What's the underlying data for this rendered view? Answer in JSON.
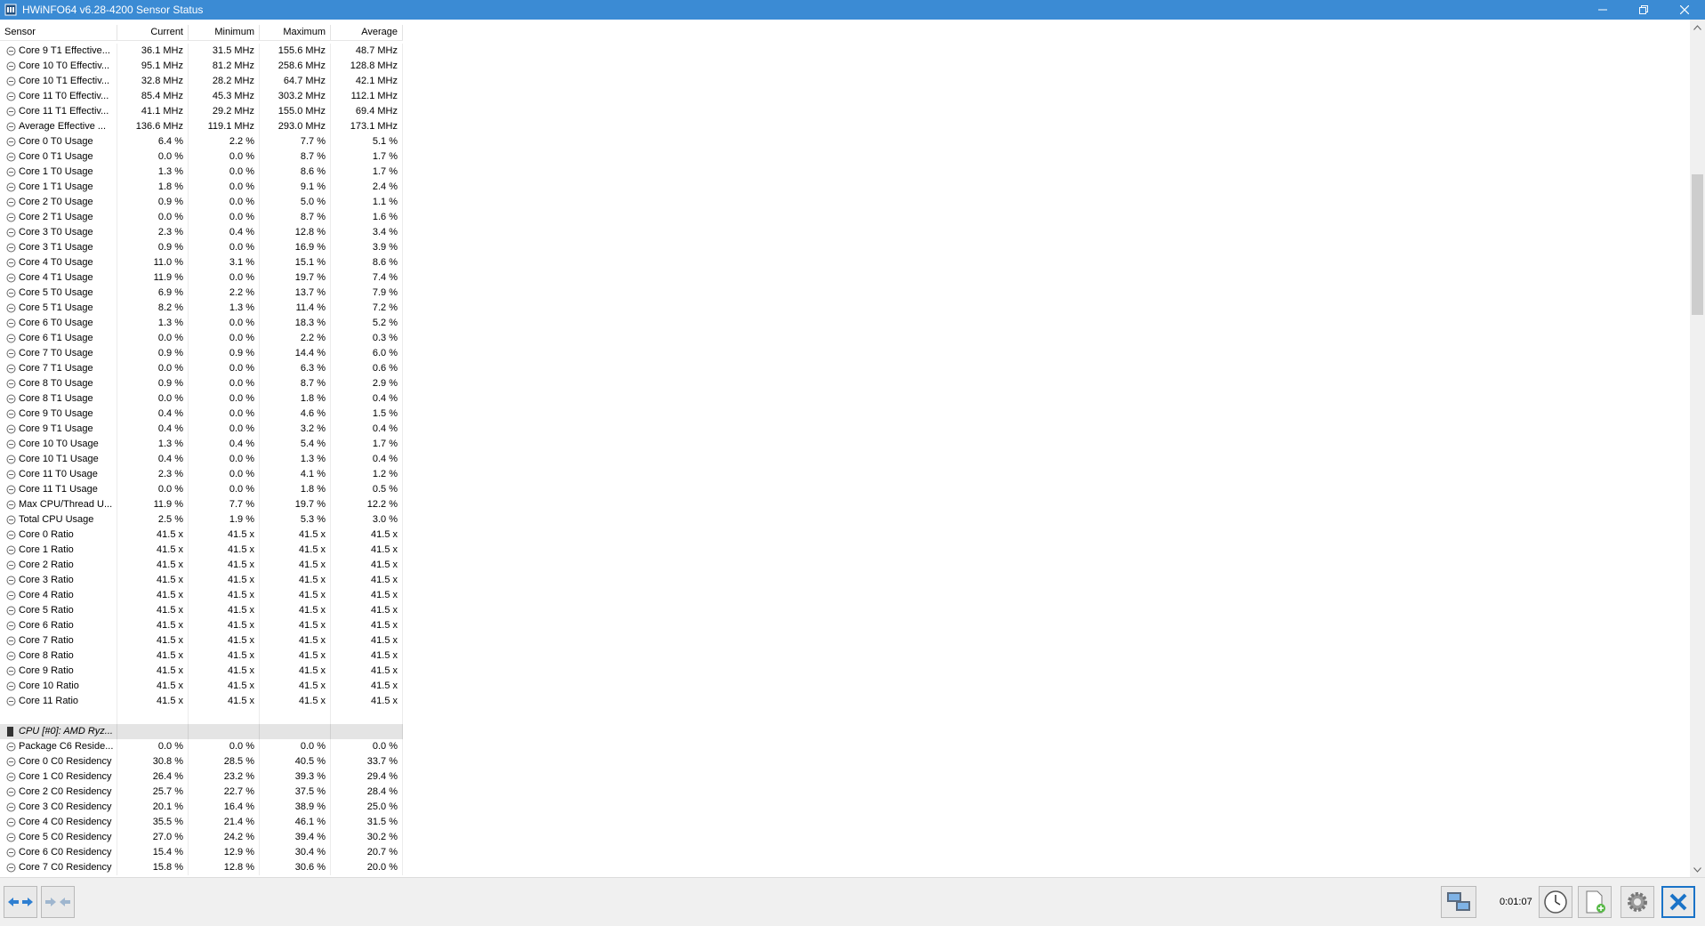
{
  "window": {
    "title": "HWiNFO64 v6.28-4200 Sensor Status",
    "colors": {
      "titlebar": "#3b8bd4",
      "group_row": "#e4e4e4",
      "close_button": "#1a73c8"
    }
  },
  "table": {
    "headers": [
      "Sensor",
      "Current",
      "Minimum",
      "Maximum",
      "Average"
    ],
    "rows": [
      {
        "name": "Core 9 T1 Effective...",
        "current": "36.1 MHz",
        "min": "31.5 MHz",
        "max": "155.6 MHz",
        "avg": "48.7 MHz"
      },
      {
        "name": "Core 10 T0 Effectiv...",
        "current": "95.1 MHz",
        "min": "81.2 MHz",
        "max": "258.6 MHz",
        "avg": "128.8 MHz"
      },
      {
        "name": "Core 10 T1 Effectiv...",
        "current": "32.8 MHz",
        "min": "28.2 MHz",
        "max": "64.7 MHz",
        "avg": "42.1 MHz"
      },
      {
        "name": "Core 11 T0 Effectiv...",
        "current": "85.4 MHz",
        "min": "45.3 MHz",
        "max": "303.2 MHz",
        "avg": "112.1 MHz"
      },
      {
        "name": "Core 11 T1 Effectiv...",
        "current": "41.1 MHz",
        "min": "29.2 MHz",
        "max": "155.0 MHz",
        "avg": "69.4 MHz"
      },
      {
        "name": "Average Effective ...",
        "current": "136.6 MHz",
        "min": "119.1 MHz",
        "max": "293.0 MHz",
        "avg": "173.1 MHz"
      },
      {
        "name": "Core 0 T0 Usage",
        "current": "6.4 %",
        "min": "2.2 %",
        "max": "7.7 %",
        "avg": "5.1 %"
      },
      {
        "name": "Core 0 T1 Usage",
        "current": "0.0 %",
        "min": "0.0 %",
        "max": "8.7 %",
        "avg": "1.7 %"
      },
      {
        "name": "Core 1 T0 Usage",
        "current": "1.3 %",
        "min": "0.0 %",
        "max": "8.6 %",
        "avg": "1.7 %"
      },
      {
        "name": "Core 1 T1 Usage",
        "current": "1.8 %",
        "min": "0.0 %",
        "max": "9.1 %",
        "avg": "2.4 %"
      },
      {
        "name": "Core 2 T0 Usage",
        "current": "0.9 %",
        "min": "0.0 %",
        "max": "5.0 %",
        "avg": "1.1 %"
      },
      {
        "name": "Core 2 T1 Usage",
        "current": "0.0 %",
        "min": "0.0 %",
        "max": "8.7 %",
        "avg": "1.6 %"
      },
      {
        "name": "Core 3 T0 Usage",
        "current": "2.3 %",
        "min": "0.4 %",
        "max": "12.8 %",
        "avg": "3.4 %"
      },
      {
        "name": "Core 3 T1 Usage",
        "current": "0.9 %",
        "min": "0.0 %",
        "max": "16.9 %",
        "avg": "3.9 %"
      },
      {
        "name": "Core 4 T0 Usage",
        "current": "11.0 %",
        "min": "3.1 %",
        "max": "15.1 %",
        "avg": "8.6 %"
      },
      {
        "name": "Core 4 T1 Usage",
        "current": "11.9 %",
        "min": "0.0 %",
        "max": "19.7 %",
        "avg": "7.4 %"
      },
      {
        "name": "Core 5 T0 Usage",
        "current": "6.9 %",
        "min": "2.2 %",
        "max": "13.7 %",
        "avg": "7.9 %"
      },
      {
        "name": "Core 5 T1 Usage",
        "current": "8.2 %",
        "min": "1.3 %",
        "max": "11.4 %",
        "avg": "7.2 %"
      },
      {
        "name": "Core 6 T0 Usage",
        "current": "1.3 %",
        "min": "0.0 %",
        "max": "18.3 %",
        "avg": "5.2 %"
      },
      {
        "name": "Core 6 T1 Usage",
        "current": "0.0 %",
        "min": "0.0 %",
        "max": "2.2 %",
        "avg": "0.3 %"
      },
      {
        "name": "Core 7 T0 Usage",
        "current": "0.9 %",
        "min": "0.9 %",
        "max": "14.4 %",
        "avg": "6.0 %"
      },
      {
        "name": "Core 7 T1 Usage",
        "current": "0.0 %",
        "min": "0.0 %",
        "max": "6.3 %",
        "avg": "0.6 %"
      },
      {
        "name": "Core 8 T0 Usage",
        "current": "0.9 %",
        "min": "0.0 %",
        "max": "8.7 %",
        "avg": "2.9 %"
      },
      {
        "name": "Core 8 T1 Usage",
        "current": "0.0 %",
        "min": "0.0 %",
        "max": "1.8 %",
        "avg": "0.4 %"
      },
      {
        "name": "Core 9 T0 Usage",
        "current": "0.4 %",
        "min": "0.0 %",
        "max": "4.6 %",
        "avg": "1.5 %"
      },
      {
        "name": "Core 9 T1 Usage",
        "current": "0.4 %",
        "min": "0.0 %",
        "max": "3.2 %",
        "avg": "0.4 %"
      },
      {
        "name": "Core 10 T0 Usage",
        "current": "1.3 %",
        "min": "0.4 %",
        "max": "5.4 %",
        "avg": "1.7 %"
      },
      {
        "name": "Core 10 T1 Usage",
        "current": "0.4 %",
        "min": "0.0 %",
        "max": "1.3 %",
        "avg": "0.4 %"
      },
      {
        "name": "Core 11 T0 Usage",
        "current": "2.3 %",
        "min": "0.0 %",
        "max": "4.1 %",
        "avg": "1.2 %"
      },
      {
        "name": "Core 11 T1 Usage",
        "current": "0.0 %",
        "min": "0.0 %",
        "max": "1.8 %",
        "avg": "0.5 %"
      },
      {
        "name": "Max CPU/Thread U...",
        "current": "11.9 %",
        "min": "7.7 %",
        "max": "19.7 %",
        "avg": "12.2 %"
      },
      {
        "name": "Total CPU Usage",
        "current": "2.5 %",
        "min": "1.9 %",
        "max": "5.3 %",
        "avg": "3.0 %"
      },
      {
        "name": "Core 0 Ratio",
        "current": "41.5 x",
        "min": "41.5 x",
        "max": "41.5 x",
        "avg": "41.5 x"
      },
      {
        "name": "Core 1 Ratio",
        "current": "41.5 x",
        "min": "41.5 x",
        "max": "41.5 x",
        "avg": "41.5 x"
      },
      {
        "name": "Core 2 Ratio",
        "current": "41.5 x",
        "min": "41.5 x",
        "max": "41.5 x",
        "avg": "41.5 x"
      },
      {
        "name": "Core 3 Ratio",
        "current": "41.5 x",
        "min": "41.5 x",
        "max": "41.5 x",
        "avg": "41.5 x"
      },
      {
        "name": "Core 4 Ratio",
        "current": "41.5 x",
        "min": "41.5 x",
        "max": "41.5 x",
        "avg": "41.5 x"
      },
      {
        "name": "Core 5 Ratio",
        "current": "41.5 x",
        "min": "41.5 x",
        "max": "41.5 x",
        "avg": "41.5 x"
      },
      {
        "name": "Core 6 Ratio",
        "current": "41.5 x",
        "min": "41.5 x",
        "max": "41.5 x",
        "avg": "41.5 x"
      },
      {
        "name": "Core 7 Ratio",
        "current": "41.5 x",
        "min": "41.5 x",
        "max": "41.5 x",
        "avg": "41.5 x"
      },
      {
        "name": "Core 8 Ratio",
        "current": "41.5 x",
        "min": "41.5 x",
        "max": "41.5 x",
        "avg": "41.5 x"
      },
      {
        "name": "Core 9 Ratio",
        "current": "41.5 x",
        "min": "41.5 x",
        "max": "41.5 x",
        "avg": "41.5 x"
      },
      {
        "name": "Core 10 Ratio",
        "current": "41.5 x",
        "min": "41.5 x",
        "max": "41.5 x",
        "avg": "41.5 x"
      },
      {
        "name": "Core 11 Ratio",
        "current": "41.5 x",
        "min": "41.5 x",
        "max": "41.5 x",
        "avg": "41.5 x"
      },
      {
        "type": "empty"
      },
      {
        "type": "group",
        "name": "CPU [#0]: AMD Ryz..."
      },
      {
        "name": "Package C6 Reside...",
        "current": "0.0 %",
        "min": "0.0 %",
        "max": "0.0 %",
        "avg": "0.0 %"
      },
      {
        "name": "Core 0 C0 Residency",
        "current": "30.8 %",
        "min": "28.5 %",
        "max": "40.5 %",
        "avg": "33.7 %"
      },
      {
        "name": "Core 1 C0 Residency",
        "current": "26.4 %",
        "min": "23.2 %",
        "max": "39.3 %",
        "avg": "29.4 %"
      },
      {
        "name": "Core 2 C0 Residency",
        "current": "25.7 %",
        "min": "22.7 %",
        "max": "37.5 %",
        "avg": "28.4 %"
      },
      {
        "name": "Core 3 C0 Residency",
        "current": "20.1 %",
        "min": "16.4 %",
        "max": "38.9 %",
        "avg": "25.0 %"
      },
      {
        "name": "Core 4 C0 Residency",
        "current": "35.5 %",
        "min": "21.4 %",
        "max": "46.1 %",
        "avg": "31.5 %"
      },
      {
        "name": "Core 5 C0 Residency",
        "current": "27.0 %",
        "min": "24.2 %",
        "max": "39.4 %",
        "avg": "30.2 %"
      },
      {
        "name": "Core 6 C0 Residency",
        "current": "15.4 %",
        "min": "12.9 %",
        "max": "30.4 %",
        "avg": "20.7 %"
      },
      {
        "name": "Core 7 C0 Residency",
        "current": "15.8 %",
        "min": "12.8 %",
        "max": "30.6 %",
        "avg": "20.0 %"
      }
    ]
  },
  "scrollbar": {
    "position_fraction": 0.18
  },
  "toolbar": {
    "timer": "0:01:07",
    "icons": [
      "nav-arrows-icon",
      "nav-arrows-disabled-icon",
      "network-icon",
      "clock-icon",
      "add-file-icon",
      "settings-icon",
      "close-icon"
    ]
  }
}
